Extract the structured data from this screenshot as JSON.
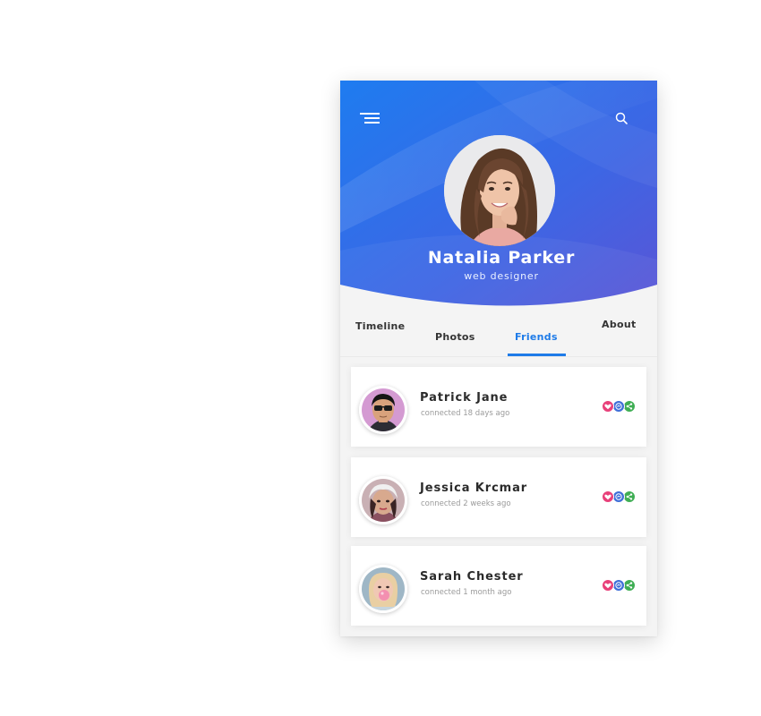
{
  "profile": {
    "name": "Natalia Parker",
    "role": "web designer"
  },
  "header": {
    "menu_icon": "hamburger-menu-icon",
    "search_icon": "search-icon"
  },
  "tabs": [
    {
      "label": "Timeline",
      "active": false
    },
    {
      "label": "Photos",
      "active": false
    },
    {
      "label": "Friends",
      "active": true
    },
    {
      "label": "About",
      "active": false
    }
  ],
  "friends": [
    {
      "name": "Patrick Jane",
      "meta": "connected 18 days ago"
    },
    {
      "name": "Jessica Krcmar",
      "meta": "connected 2 weeks ago"
    },
    {
      "name": "Sarah Chester",
      "meta": "connected 1 month ago"
    }
  ],
  "friend_actions": [
    "heart-icon",
    "messenger-icon",
    "share-icon"
  ],
  "colors": {
    "header_gradient_start": "#1e7cf0",
    "header_gradient_end": "#5a55d6",
    "accent": "#1e7be8",
    "heart": "#e8407a",
    "messenger": "#3f6fd8",
    "share": "#3fae54"
  }
}
